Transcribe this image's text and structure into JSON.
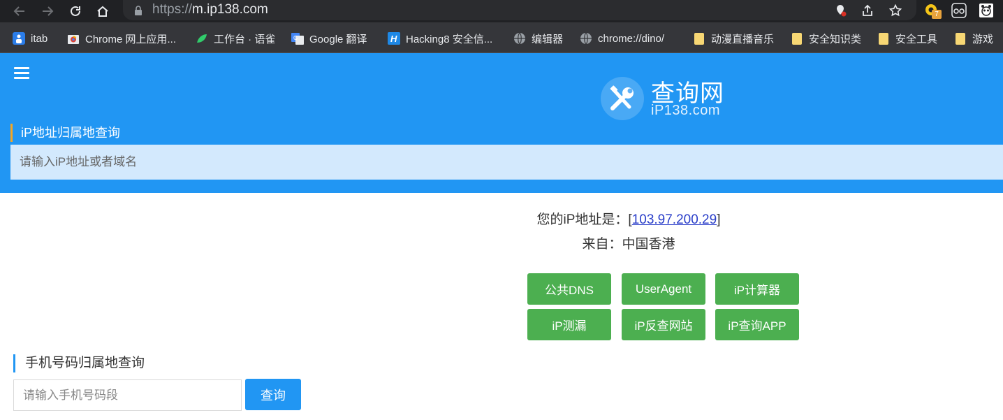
{
  "browser": {
    "url_scheme": "https://",
    "url_host": "m.ip138.com",
    "extension_badge": "7",
    "bookmarks": [
      {
        "label": "itab",
        "icon": "itab-icon"
      },
      {
        "label": "Chrome 网上应用...",
        "icon": "chrome-store-icon"
      },
      {
        "label": "工作台 · 语雀",
        "icon": "yuque-icon"
      },
      {
        "label": "Google 翻译",
        "icon": "google-translate-icon"
      },
      {
        "label": "Hacking8 安全信...",
        "icon": "hacking8-icon"
      },
      {
        "label": "编辑器",
        "icon": "globe-icon"
      },
      {
        "label": "chrome://dino/",
        "icon": "globe-icon"
      },
      {
        "label": "动漫直播音乐",
        "icon": "folder-icon"
      },
      {
        "label": "安全知识类",
        "icon": "folder-icon"
      },
      {
        "label": "安全工具",
        "icon": "folder-icon"
      },
      {
        "label": "游戏",
        "icon": "folder-icon"
      }
    ]
  },
  "header": {
    "logo_cn": "查询网",
    "logo_en": "iP138.com",
    "ip_section_title": "iP地址归属地查询",
    "ip_input_placeholder": "请输入iP地址或者域名"
  },
  "result": {
    "ip_prefix": "您的iP地址是：[",
    "ip_value": "103.97.200.29",
    "ip_suffix": "]",
    "from_label": "来自：中国香港"
  },
  "tools": [
    {
      "label": "公共DNS"
    },
    {
      "label": "UserAgent"
    },
    {
      "label": "iP计算器"
    },
    {
      "label": "iP测漏"
    },
    {
      "label": "iP反查网站"
    },
    {
      "label": "iP查询APP"
    }
  ],
  "phone": {
    "title": "手机号码归属地查询",
    "input_placeholder": "请输入手机号码段",
    "button_label": "查询"
  },
  "colors": {
    "primary": "#2196f3",
    "accent_bar": "#f5a623",
    "tool_button": "#4caf50",
    "input_bg": "#d3e9fd"
  }
}
